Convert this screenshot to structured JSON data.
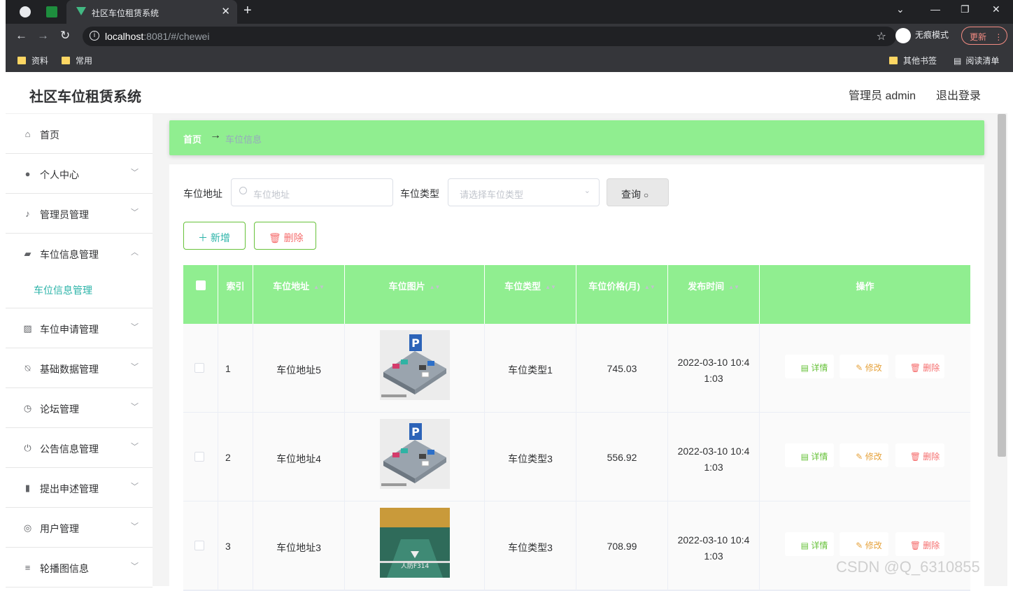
{
  "browser": {
    "tab_title": "社区车位租赁系统",
    "url_host": "localhost",
    "url_rest": ":8081/#/chewei",
    "incognito_label": "无痕模式",
    "update_label": "更新",
    "bookmarks": [
      "资料",
      "常用"
    ],
    "other_bookmarks": "其他书签",
    "reading_list": "阅读清单"
  },
  "header": {
    "title": "社区车位租赁系统",
    "user": "管理员 admin",
    "logout": "退出登录"
  },
  "sidebar": {
    "items": [
      {
        "label": "首页",
        "icon": "home-icon"
      },
      {
        "label": "个人中心",
        "icon": "user-icon"
      },
      {
        "label": "管理员管理",
        "icon": "microphone-icon"
      },
      {
        "label": "车位信息管理",
        "icon": "wallet-icon",
        "expanded": true
      },
      {
        "label": "车位申请管理",
        "icon": "chart-icon"
      },
      {
        "label": "基础数据管理",
        "icon": "bell-off-icon"
      },
      {
        "label": "论坛管理",
        "icon": "clock-icon"
      },
      {
        "label": "公告信息管理",
        "icon": "power-icon"
      },
      {
        "label": "提出申述管理",
        "icon": "books-icon"
      },
      {
        "label": "用户管理",
        "icon": "aperture-icon"
      },
      {
        "label": "轮播图信息",
        "icon": "list-icon"
      }
    ],
    "sub_active": "车位信息管理"
  },
  "breadcrumb": {
    "home": "首页",
    "current": "车位信息"
  },
  "search": {
    "address_label": "车位地址",
    "address_placeholder": "车位地址",
    "type_label": "车位类型",
    "type_placeholder": "请选择车位类型",
    "query_button": "查询"
  },
  "actions": {
    "add": "新增",
    "delete": "删除"
  },
  "table": {
    "headers": {
      "index": "索引",
      "address": "车位地址",
      "image": "车位图片",
      "type": "车位类型",
      "price": "车位价格(月)",
      "time": "发布时间",
      "ops": "操作"
    },
    "rows": [
      {
        "index": "1",
        "address": "车位地址5",
        "type": "车位类型1",
        "price": "745.03",
        "time1": "2022-03-10 10:4",
        "time2": "1:03",
        "image": "parking-lot-illustration"
      },
      {
        "index": "2",
        "address": "车位地址4",
        "type": "车位类型3",
        "price": "556.92",
        "time1": "2022-03-10 10:4",
        "time2": "1:03",
        "image": "parking-lot-illustration"
      },
      {
        "index": "3",
        "address": "车位地址3",
        "type": "车位类型3",
        "price": "708.99",
        "time1": "2022-03-10 10:4",
        "time2": "1:03",
        "image": "parking-space-photo"
      }
    ],
    "ops": {
      "detail": "详情",
      "edit": "修改",
      "delete": "删除"
    }
  },
  "watermark": "CSDN @Q_6310855",
  "colors": {
    "accent": "#90ee90",
    "teal": "#2bb3a8",
    "danger": "#f56c6c",
    "warning": "#e6a23c",
    "success": "#67c23a"
  }
}
